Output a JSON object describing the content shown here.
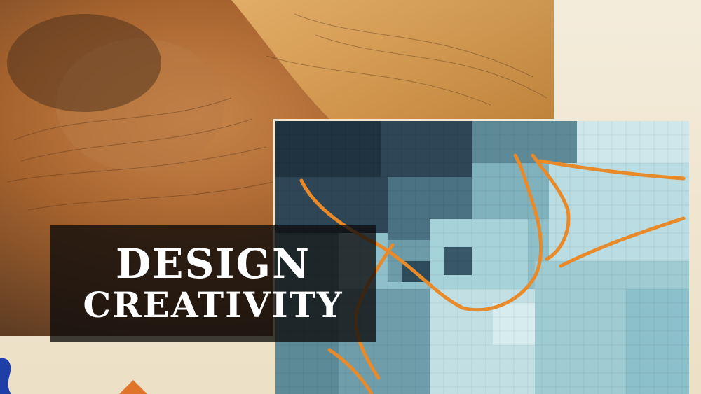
{
  "title": {
    "line1": "DESIGN",
    "line2": "CREATIVITY"
  },
  "colors": {
    "sepia_light": "#d9a76a",
    "sepia_dark": "#5a3a22",
    "paper": "#f0e6d0",
    "cyan_light": "#a8d0d8",
    "cyan_dark": "#1f3c4c",
    "orange_line": "#e88a2a",
    "blue_mark": "#1f3fa8",
    "title_bg": "#0c0a0a",
    "title_text": "#ffffff"
  }
}
